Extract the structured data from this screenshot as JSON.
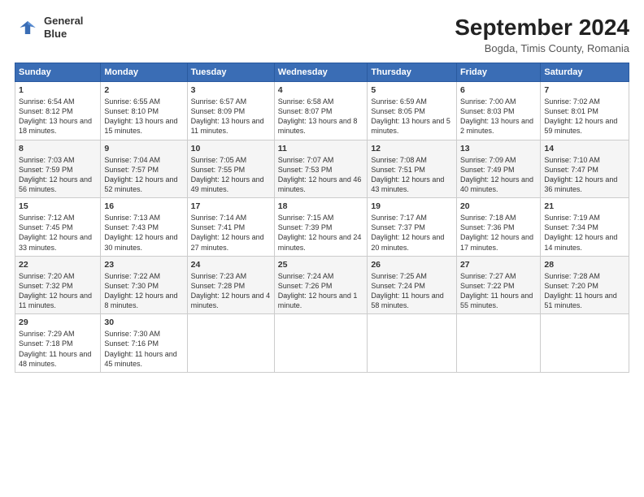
{
  "header": {
    "logo_line1": "General",
    "logo_line2": "Blue",
    "title": "September 2024",
    "subtitle": "Bogda, Timis County, Romania"
  },
  "columns": [
    "Sunday",
    "Monday",
    "Tuesday",
    "Wednesday",
    "Thursday",
    "Friday",
    "Saturday"
  ],
  "rows": [
    [
      {
        "day": "1",
        "text": "Sunrise: 6:54 AM\nSunset: 8:12 PM\nDaylight: 13 hours and 18 minutes."
      },
      {
        "day": "2",
        "text": "Sunrise: 6:55 AM\nSunset: 8:10 PM\nDaylight: 13 hours and 15 minutes."
      },
      {
        "day": "3",
        "text": "Sunrise: 6:57 AM\nSunset: 8:09 PM\nDaylight: 13 hours and 11 minutes."
      },
      {
        "day": "4",
        "text": "Sunrise: 6:58 AM\nSunset: 8:07 PM\nDaylight: 13 hours and 8 minutes."
      },
      {
        "day": "5",
        "text": "Sunrise: 6:59 AM\nSunset: 8:05 PM\nDaylight: 13 hours and 5 minutes."
      },
      {
        "day": "6",
        "text": "Sunrise: 7:00 AM\nSunset: 8:03 PM\nDaylight: 13 hours and 2 minutes."
      },
      {
        "day": "7",
        "text": "Sunrise: 7:02 AM\nSunset: 8:01 PM\nDaylight: 12 hours and 59 minutes."
      }
    ],
    [
      {
        "day": "8",
        "text": "Sunrise: 7:03 AM\nSunset: 7:59 PM\nDaylight: 12 hours and 56 minutes."
      },
      {
        "day": "9",
        "text": "Sunrise: 7:04 AM\nSunset: 7:57 PM\nDaylight: 12 hours and 52 minutes."
      },
      {
        "day": "10",
        "text": "Sunrise: 7:05 AM\nSunset: 7:55 PM\nDaylight: 12 hours and 49 minutes."
      },
      {
        "day": "11",
        "text": "Sunrise: 7:07 AM\nSunset: 7:53 PM\nDaylight: 12 hours and 46 minutes."
      },
      {
        "day": "12",
        "text": "Sunrise: 7:08 AM\nSunset: 7:51 PM\nDaylight: 12 hours and 43 minutes."
      },
      {
        "day": "13",
        "text": "Sunrise: 7:09 AM\nSunset: 7:49 PM\nDaylight: 12 hours and 40 minutes."
      },
      {
        "day": "14",
        "text": "Sunrise: 7:10 AM\nSunset: 7:47 PM\nDaylight: 12 hours and 36 minutes."
      }
    ],
    [
      {
        "day": "15",
        "text": "Sunrise: 7:12 AM\nSunset: 7:45 PM\nDaylight: 12 hours and 33 minutes."
      },
      {
        "day": "16",
        "text": "Sunrise: 7:13 AM\nSunset: 7:43 PM\nDaylight: 12 hours and 30 minutes."
      },
      {
        "day": "17",
        "text": "Sunrise: 7:14 AM\nSunset: 7:41 PM\nDaylight: 12 hours and 27 minutes."
      },
      {
        "day": "18",
        "text": "Sunrise: 7:15 AM\nSunset: 7:39 PM\nDaylight: 12 hours and 24 minutes."
      },
      {
        "day": "19",
        "text": "Sunrise: 7:17 AM\nSunset: 7:37 PM\nDaylight: 12 hours and 20 minutes."
      },
      {
        "day": "20",
        "text": "Sunrise: 7:18 AM\nSunset: 7:36 PM\nDaylight: 12 hours and 17 minutes."
      },
      {
        "day": "21",
        "text": "Sunrise: 7:19 AM\nSunset: 7:34 PM\nDaylight: 12 hours and 14 minutes."
      }
    ],
    [
      {
        "day": "22",
        "text": "Sunrise: 7:20 AM\nSunset: 7:32 PM\nDaylight: 12 hours and 11 minutes."
      },
      {
        "day": "23",
        "text": "Sunrise: 7:22 AM\nSunset: 7:30 PM\nDaylight: 12 hours and 8 minutes."
      },
      {
        "day": "24",
        "text": "Sunrise: 7:23 AM\nSunset: 7:28 PM\nDaylight: 12 hours and 4 minutes."
      },
      {
        "day": "25",
        "text": "Sunrise: 7:24 AM\nSunset: 7:26 PM\nDaylight: 12 hours and 1 minute."
      },
      {
        "day": "26",
        "text": "Sunrise: 7:25 AM\nSunset: 7:24 PM\nDaylight: 11 hours and 58 minutes."
      },
      {
        "day": "27",
        "text": "Sunrise: 7:27 AM\nSunset: 7:22 PM\nDaylight: 11 hours and 55 minutes."
      },
      {
        "day": "28",
        "text": "Sunrise: 7:28 AM\nSunset: 7:20 PM\nDaylight: 11 hours and 51 minutes."
      }
    ],
    [
      {
        "day": "29",
        "text": "Sunrise: 7:29 AM\nSunset: 7:18 PM\nDaylight: 11 hours and 48 minutes."
      },
      {
        "day": "30",
        "text": "Sunrise: 7:30 AM\nSunset: 7:16 PM\nDaylight: 11 hours and 45 minutes."
      },
      {
        "day": "",
        "text": ""
      },
      {
        "day": "",
        "text": ""
      },
      {
        "day": "",
        "text": ""
      },
      {
        "day": "",
        "text": ""
      },
      {
        "day": "",
        "text": ""
      }
    ]
  ]
}
